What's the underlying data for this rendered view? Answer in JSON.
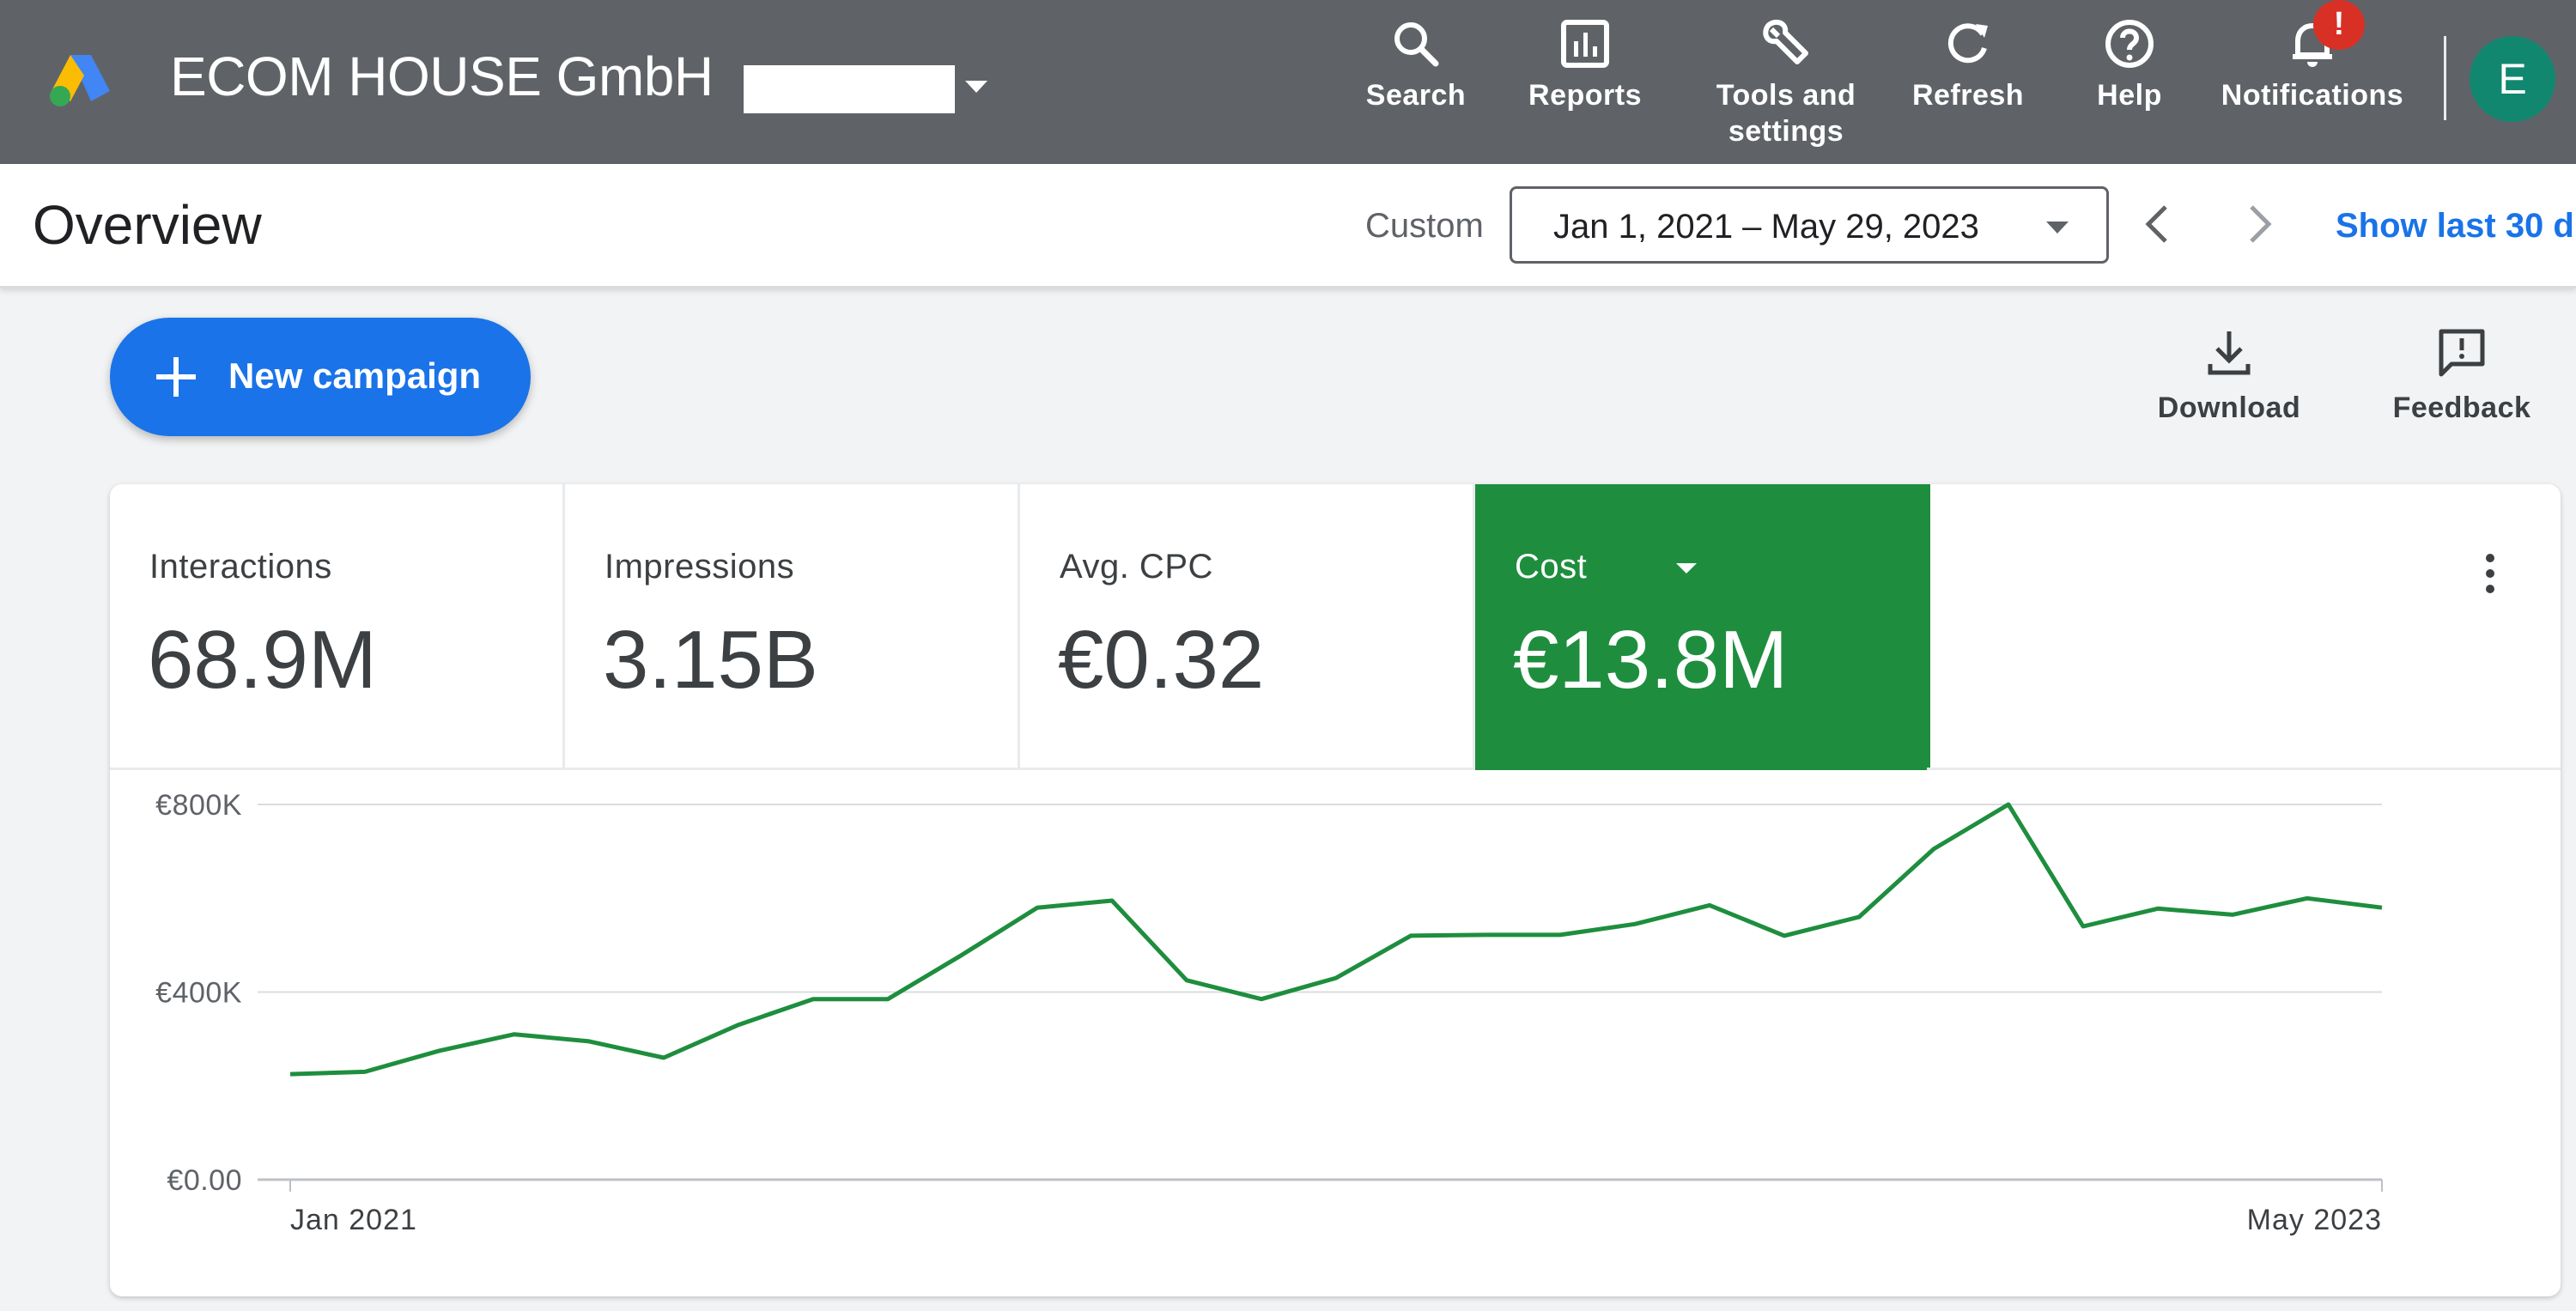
{
  "account": {
    "name": "ECOM HOUSE GmbH"
  },
  "nav": {
    "items": [
      {
        "label": "Search",
        "icon": "search-icon"
      },
      {
        "label": "Reports",
        "icon": "reports-icon"
      },
      {
        "label": "Tools and\nsettings",
        "icon": "wrench-icon"
      },
      {
        "label": "Refresh",
        "icon": "refresh-icon"
      },
      {
        "label": "Help",
        "icon": "help-icon"
      },
      {
        "label": "Notifications",
        "icon": "bell-icon"
      }
    ],
    "notification_badge": "!",
    "avatar_letter": "E"
  },
  "header": {
    "title": "Overview",
    "custom_label": "Custom",
    "date_range": "Jan 1, 2021 – May 29, 2023",
    "show_last": "Show last 30 d"
  },
  "actions": {
    "new_campaign": "New campaign",
    "download": "Download",
    "feedback": "Feedback"
  },
  "metrics": [
    {
      "label": "Interactions",
      "value": "68.9M"
    },
    {
      "label": "Impressions",
      "value": "3.15B"
    },
    {
      "label": "Avg. CPC",
      "value": "€0.32"
    },
    {
      "label": "Cost",
      "value": "€13.8M",
      "active": true
    }
  ],
  "colors": {
    "topbar": "#5f6368",
    "accent_blue": "#1a73e8",
    "cost_green": "#1e8e3e",
    "line": "#1e8e3e",
    "avatar": "#12876f",
    "badge": "#d93025"
  },
  "chart_data": {
    "type": "line",
    "series": [
      {
        "name": "Cost",
        "values": [
          225000,
          230000,
          275000,
          310000,
          295000,
          260000,
          330000,
          385000,
          385000,
          480000,
          580000,
          595000,
          425000,
          385000,
          430000,
          520000,
          522000,
          522000,
          545000,
          585000,
          520000,
          560000,
          705000,
          800000,
          540000,
          578000,
          565000,
          600000,
          580000
        ]
      }
    ],
    "x_tick_labels": [
      "Jan 2021",
      "May 2023"
    ],
    "y_tick_labels": [
      "€0.00",
      "€400K",
      "€800K"
    ],
    "ylim": [
      0,
      800000
    ],
    "grid": true
  }
}
